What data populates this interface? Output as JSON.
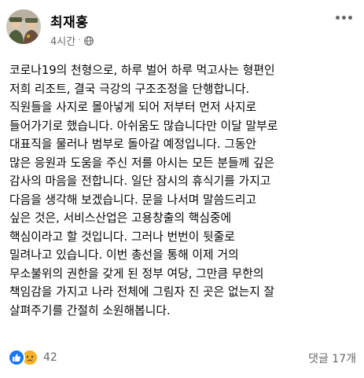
{
  "post": {
    "author": "최재홍",
    "time": "4시간",
    "separator": "·",
    "privacy_icon": "globe-icon",
    "more_icon": "more-options-icon",
    "lines": [
      "코로나19의 천형으로, 하루 벌어 하루 먹고사는 형편인",
      "저희 리조트, 결국 극강의 구조조정을 단행합니다.",
      "직원들을 사지로 몰아넣게 되어 저부터 먼저 사지로",
      "들어가기로 했습니다. 아쉬움도 많습니다만 이달 말부로",
      "대표직을 물러나 범부로 돌아갈 예정입니다. 그동안",
      "많은 응원과 도움을 주신 저를 아시는 모든 분들께 깊은",
      "감사의 마음을 전합니다. 일단 잠시의 휴식기를 가지고",
      "다음을 생각해 보겠습니다. 문을 나서며 말씀드리고",
      "싶은 것은, 서비스산업은 고용창출의 핵심중에",
      "핵심이라고 할 것입니다. 그러나 번번이 뒷줄로",
      "밀려나고 있습니다. 이번 총선을 통해 이제 거의",
      "무소불위의 권한을 갖게 된 정부 여당, 그만큼 무한의",
      "책임감을 가지고 나라 전체에 그림자 진 곳은 없는지 잘",
      "살펴주기를 간절히 소원해봅니다."
    ]
  },
  "footer": {
    "reaction_icons": [
      "like-icon",
      "sad-icon"
    ],
    "reaction_count": "42",
    "comments": "댓글 17개"
  },
  "colors": {
    "like": "#1877f2",
    "sad": "#f7b125",
    "secondary_text": "#65676b"
  }
}
